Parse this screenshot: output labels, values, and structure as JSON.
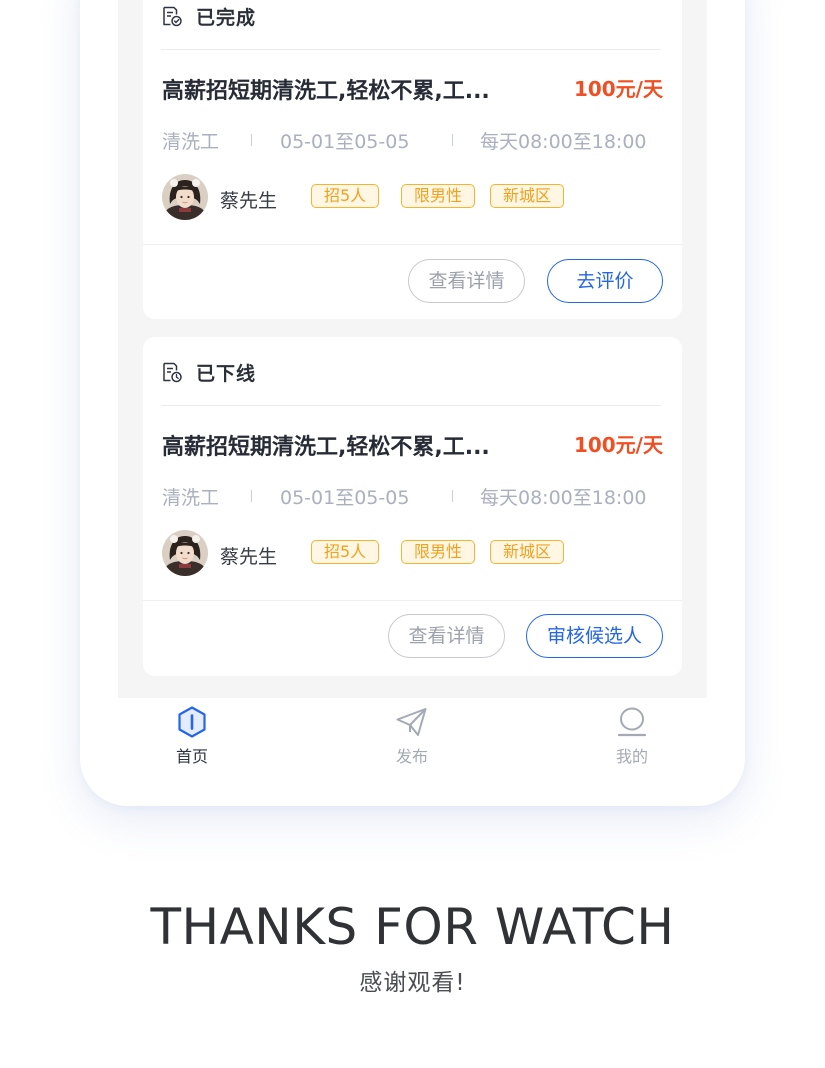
{
  "cards": [
    {
      "status": "已完成",
      "title": "高薪招短期清洗工,轻松不累,工...",
      "price": "100元/天",
      "job_type": "清洗工",
      "dates": "05-01至05-05",
      "hours": "每天08:00至18:00",
      "poster": "蔡先生",
      "tags": [
        "招5人",
        "限男性",
        "新城区"
      ],
      "secondary_button": "查看详情",
      "primary_button": "去评价"
    },
    {
      "status": "已下线",
      "title": "高薪招短期清洗工,轻松不累,工...",
      "price": "100元/天",
      "job_type": "清洗工",
      "dates": "05-01至05-05",
      "hours": "每天08:00至18:00",
      "poster": "蔡先生",
      "tags": [
        "招5人",
        "限男性",
        "新城区"
      ],
      "secondary_button": "查看详情",
      "primary_button": "审核候选人"
    }
  ],
  "tabbar": {
    "items": [
      {
        "label": "首页",
        "icon": "home-shield-icon",
        "active": true
      },
      {
        "label": "发布",
        "icon": "paper-plane-icon",
        "active": false
      },
      {
        "label": "我的",
        "icon": "profile-icon",
        "active": false
      }
    ]
  },
  "footer": {
    "thanks_en": "THANKS FOR WATCH",
    "thanks_cn": "感谢观看!"
  },
  "colors": {
    "accent_blue": "#2466e7",
    "price_orange": "#f04f23",
    "tag_yellow": "#f4b52e",
    "text_dark": "#272b36",
    "text_muted": "#aab0bd"
  }
}
